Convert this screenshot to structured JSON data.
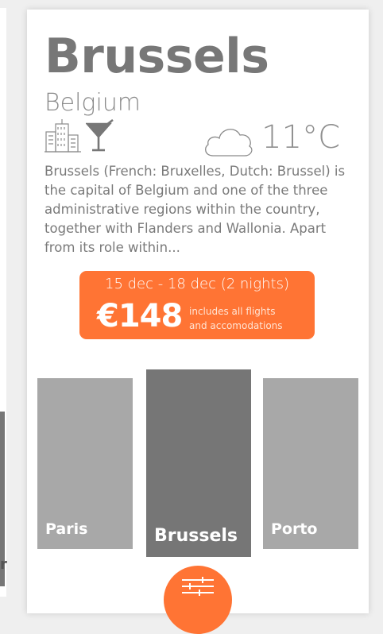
{
  "adjacent_card": {
    "label_fragment": "r"
  },
  "destination": {
    "city": "Brussels",
    "country": "Belgium",
    "category_icons": [
      "city-buildings-icon",
      "cocktail-icon"
    ],
    "weather": {
      "icon": "cloud-icon",
      "temperature": "11°C"
    },
    "description": "Brussels (French: Bruxelles, Dutch: Brussel) is the capital of Belgium and one of the three administrative regions within the country, together with Flanders and Wallonia. Apart from its role within..."
  },
  "offer": {
    "dates": "15 dec - 18 dec (2 nights)",
    "price": "€148",
    "includes_line1": "includes all flights",
    "includes_line2": "and accomodations"
  },
  "city_tiles": [
    {
      "label": "Paris",
      "selected": false
    },
    {
      "label": "Brussels",
      "selected": true
    },
    {
      "label": "Porto",
      "selected": false
    }
  ],
  "filter_button": {
    "icon": "sliders-icon"
  },
  "colors": {
    "accent": "#ff7434",
    "title_gray": "#777777",
    "tile_gray": "#a8a8a8",
    "tile_selected": "#767676"
  }
}
